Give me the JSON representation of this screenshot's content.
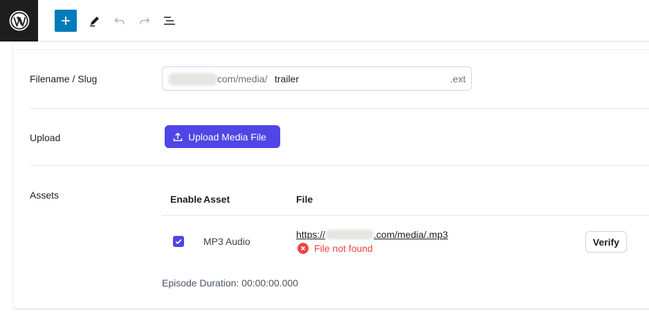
{
  "toolbar": {
    "icons": [
      "wordpress-logo-icon",
      "plus-icon",
      "pencil-icon",
      "undo-icon",
      "redo-icon",
      "list-view-icon"
    ],
    "accent": "#007cba"
  },
  "fields": {
    "slug": {
      "label": "Filename / Slug",
      "prefix": "com/media/",
      "value": "trailer",
      "suffix": ".ext"
    },
    "upload": {
      "label": "Upload",
      "button_label": "Upload Media File",
      "icon": "upload-icon"
    },
    "assets": {
      "label": "Assets",
      "columns": [
        "Enable",
        "Asset",
        "File"
      ],
      "rows": [
        {
          "enabled": true,
          "asset": "MP3 Audio",
          "file_prefix": "https://",
          "file_suffix": ".com/media/.mp3",
          "status": "File not found",
          "action": "Verify"
        }
      ]
    },
    "duration": "Episode Duration: 00:00:00.000"
  },
  "colors": {
    "primary": "#4f46e5",
    "error": "#ef4444",
    "wp_blue": "#007cba"
  }
}
